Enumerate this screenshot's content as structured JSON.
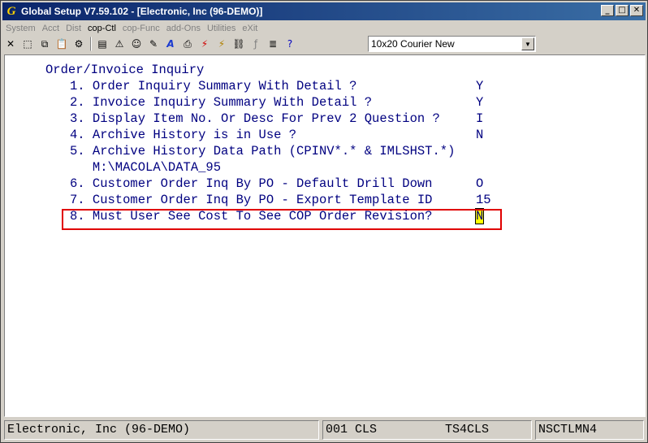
{
  "window": {
    "title": "Global Setup V7.59.102 - [Electronic, Inc (96-DEMO)]",
    "app_icon_glyph": "G",
    "buttons": {
      "minimize": "_",
      "maximize": "□",
      "close": "✕"
    }
  },
  "menu": {
    "items": [
      {
        "label": "System",
        "active": false
      },
      {
        "label": "Acct",
        "active": false
      },
      {
        "label": "Dist",
        "active": false
      },
      {
        "label": "cop-Ctl",
        "active": true
      },
      {
        "label": "cop-Func",
        "active": false
      },
      {
        "label": "add-Ons",
        "active": false
      },
      {
        "label": "Utilities",
        "active": false
      },
      {
        "label": "eXit",
        "active": false
      }
    ]
  },
  "toolbar": {
    "font_select_value": "10x20 Courier New"
  },
  "screen": {
    "heading": "Order/Invoice Inquiry",
    "rows": [
      {
        "text": "1. Order Inquiry Summary With Detail ?",
        "value": "Y"
      },
      {
        "text": "2. Invoice Inquiry Summary With Detail ?",
        "value": "Y"
      },
      {
        "text": "3. Display Item No. Or Desc For Prev 2 Question ?",
        "value": "I"
      },
      {
        "text": "4. Archive History is in Use ?",
        "value": "N"
      },
      {
        "text": "5. Archive History Data Path (CPINV*.* & IMLSHST.*)",
        "value": ""
      },
      {
        "text": "   M:\\MACOLA\\DATA_95",
        "value": ""
      },
      {
        "text": "6. Customer Order Inq By PO - Default Drill Down",
        "value": "O"
      },
      {
        "text": "7. Customer Order Inq By PO - Export Template ID",
        "value": "15"
      },
      {
        "text": "8. Must User See Cost To See COP Order Revision?",
        "value": "N"
      }
    ]
  },
  "status": {
    "company": "Electronic, Inc (96-DEMO)",
    "user": "001 CLS",
    "terminal": "TS4CLS",
    "program": "NSCTLMN4"
  },
  "colors": {
    "screen_text": "#000080",
    "highlight_border": "#e00000",
    "cursor_bg": "#ffff00"
  }
}
